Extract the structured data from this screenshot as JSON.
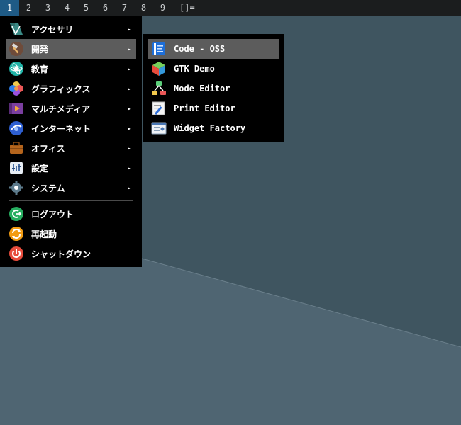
{
  "topbar": {
    "workspaces": [
      "1",
      "2",
      "3",
      "4",
      "5",
      "6",
      "7",
      "8",
      "9"
    ],
    "active_workspace": "1",
    "layout_indicator": "[]="
  },
  "menu": {
    "categories": [
      {
        "label": "アクセサリ",
        "icon": "accessories-icon",
        "has_submenu": true
      },
      {
        "label": "開発",
        "icon": "development-icon",
        "has_submenu": true,
        "selected": true
      },
      {
        "label": "教育",
        "icon": "education-icon",
        "has_submenu": true
      },
      {
        "label": "グラフィックス",
        "icon": "graphics-icon",
        "has_submenu": true
      },
      {
        "label": "マルチメディア",
        "icon": "multimedia-icon",
        "has_submenu": true
      },
      {
        "label": "インターネット",
        "icon": "internet-icon",
        "has_submenu": true
      },
      {
        "label": "オフィス",
        "icon": "office-icon",
        "has_submenu": true
      },
      {
        "label": "設定",
        "icon": "settings-icon",
        "has_submenu": true
      },
      {
        "label": "システム",
        "icon": "system-icon",
        "has_submenu": true
      }
    ],
    "actions": [
      {
        "label": "ログアウト",
        "icon": "logout-icon"
      },
      {
        "label": "再起動",
        "icon": "reboot-icon"
      },
      {
        "label": "シャットダウン",
        "icon": "shutdown-icon"
      }
    ],
    "submenu_arrow": "►"
  },
  "submenu": {
    "items": [
      {
        "label": "Code - OSS",
        "icon": "code-oss-icon",
        "selected": true
      },
      {
        "label": "GTK Demo",
        "icon": "gtk-demo-icon"
      },
      {
        "label": "Node Editor",
        "icon": "node-editor-icon"
      },
      {
        "label": "Print Editor",
        "icon": "print-editor-icon"
      },
      {
        "label": "Widget Factory",
        "icon": "widget-factory-icon"
      }
    ]
  },
  "colors": {
    "desktop": "#4e6370",
    "topbar": "#1b1d1e",
    "active_workspace": "#1f5b86",
    "menu_bg": "#000000",
    "selected_item": "#5c5c5c"
  }
}
